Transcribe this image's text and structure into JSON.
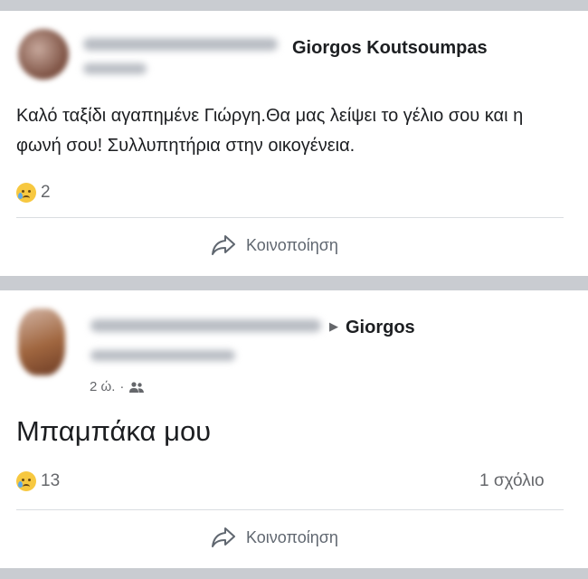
{
  "post1": {
    "author": "Giorgos Koutsoumpas",
    "text": "Καλό ταξίδι αγαπημένε Γιώργη.Θα μας λείψει το γέλιο σου και η φωνή σου! Συλλυπητήρια στην οικογένεια.",
    "reaction_count": "2",
    "share_label": "Κοινοποίηση"
  },
  "post2": {
    "arrow": "▶",
    "target": "Giorgos",
    "time": "2 ώ.",
    "dot": "·",
    "text": "Μπαμπάκα μου",
    "reaction_count": "13",
    "comments": "1 σχόλιο",
    "share_label": "Κοινοποίηση"
  },
  "colors": {
    "divider": "#c9ccd1",
    "text": "#1c1e21",
    "secondary": "#65676b",
    "reaction": "#f7c840"
  },
  "icons": [
    "sad-reaction-icon",
    "share-icon",
    "friends-audience-icon"
  ]
}
